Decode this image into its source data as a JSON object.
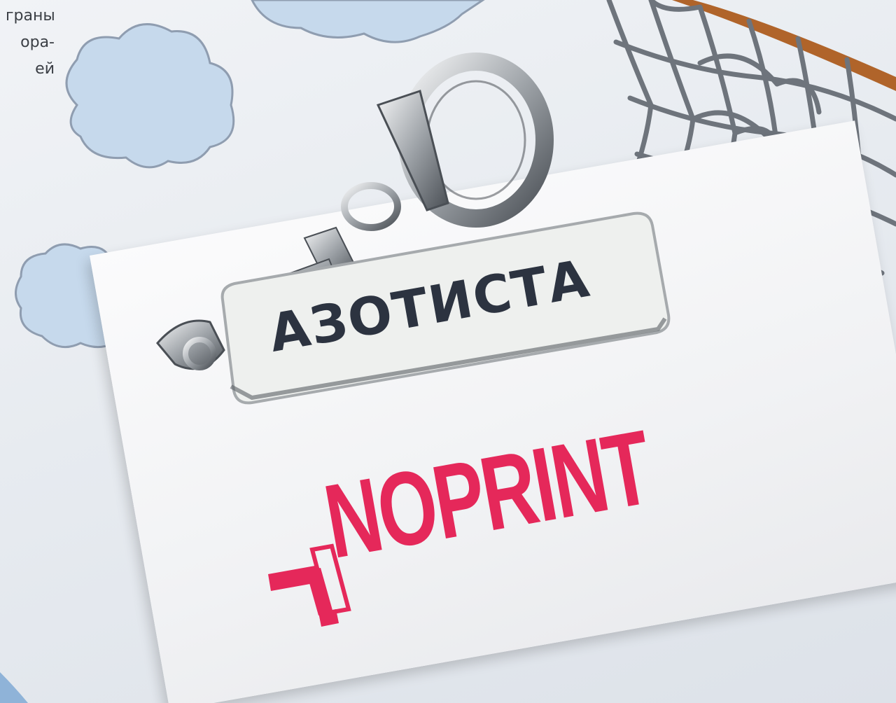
{
  "background_page": {
    "text_lines": [
      "граны",
      "ора-",
      "ей"
    ]
  },
  "keychain": {
    "tag_text": "АЗОТИСТА"
  },
  "card": {
    "brand_text": "NOPRINT",
    "brand_color": "#e5285a"
  },
  "colors": {
    "cloud": "#c6d9ec",
    "cloud_outline": "#9ba9b8",
    "net": "#6e747c",
    "tag_text": "#2c3340"
  }
}
